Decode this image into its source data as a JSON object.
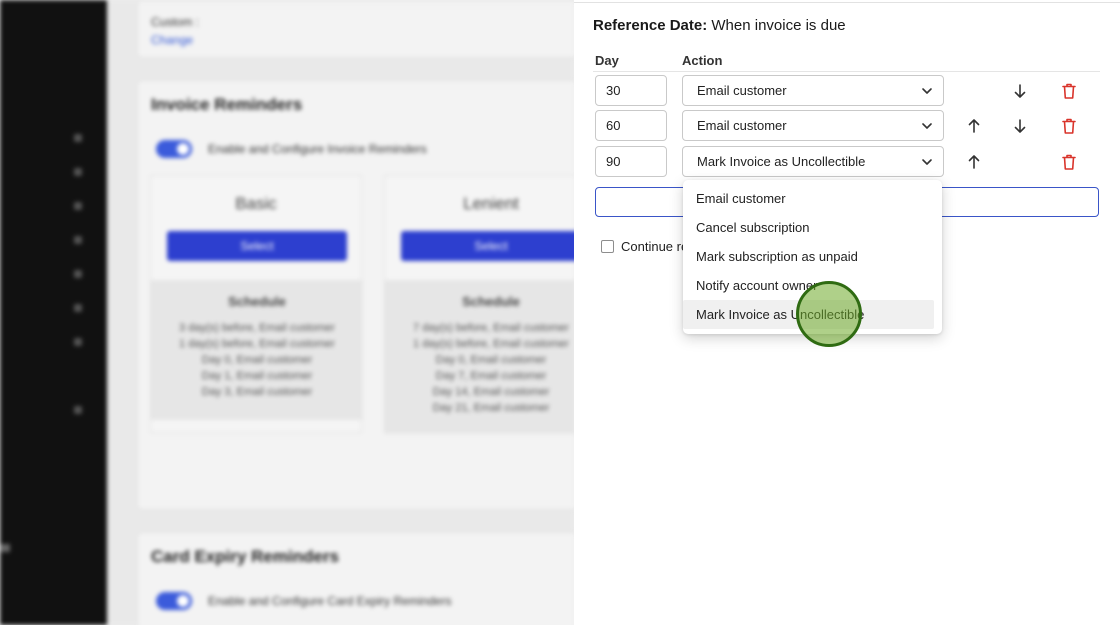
{
  "background": {
    "customer_label": "Custom :",
    "change_link": "Change",
    "invoice_reminders": {
      "title": "Invoice Reminders",
      "toggle_label": "Enable and Configure Invoice Reminders",
      "plans": [
        {
          "name": "Basic",
          "button": "Select",
          "schedule_title": "Schedule",
          "lines": [
            "3 day(s) before, Email customer",
            "1 day(s) before, Email customer",
            "Day 0, Email customer",
            "Day 1, Email customer",
            "Day 3, Email customer"
          ]
        },
        {
          "name": "Lenient",
          "button": "Select",
          "schedule_title": "Schedule",
          "lines": [
            "7 day(s) before, Email customer",
            "1 day(s) before, Email customer",
            "Day 0, Email customer",
            "Day 7, Email customer",
            "Day 14, Email customer",
            "Day 21, Email customer"
          ]
        }
      ]
    },
    "card_expiry": {
      "title": "Card Expiry Reminders",
      "toggle_label": "Enable and Configure Card Expiry Reminders"
    }
  },
  "panel": {
    "reference_label": "Reference Date:",
    "reference_value": "When invoice is due",
    "col_day": "Day",
    "col_action": "Action",
    "rows": [
      {
        "day": "30",
        "action": "Email customer"
      },
      {
        "day": "60",
        "action": "Email customer"
      },
      {
        "day": "90",
        "action": "Mark Invoice as Uncollectible"
      }
    ],
    "continue_label": "Continue re"
  },
  "dropdown": {
    "options": [
      "Email customer",
      "Cancel subscription",
      "Mark subscription as unpaid",
      "Notify account owner",
      "Mark Invoice as Uncollectible"
    ],
    "highlighted_index": 4
  },
  "colors": {
    "accent": "#3a55c8",
    "danger": "#d9342b",
    "cursor_fill": "#6eaa28",
    "cursor_border": "#2f6b12"
  },
  "icons": {
    "move_down": "arrow-down-icon",
    "move_up": "arrow-up-icon",
    "delete": "trash-icon",
    "dropdown": "chevron-down-icon"
  }
}
